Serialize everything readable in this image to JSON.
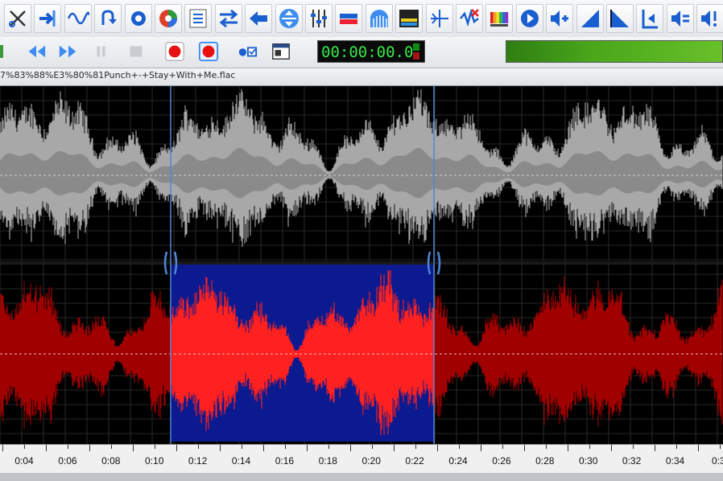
{
  "toolbar_top": {
    "buttons": [
      {
        "icon": "cut-tools-icon"
      },
      {
        "icon": "insert-arrow-icon"
      },
      {
        "icon": "sine-wave-icon"
      },
      {
        "icon": "undo-loop-icon"
      },
      {
        "icon": "gear-chip-icon"
      },
      {
        "icon": "color-wheel-icon"
      },
      {
        "icon": "marker-list-icon"
      },
      {
        "icon": "swap-channels-icon"
      },
      {
        "icon": "arrow-left-icon"
      },
      {
        "icon": "vertical-fit-icon"
      },
      {
        "icon": "equalizer-sliders-icon"
      },
      {
        "icon": "normalize-icon"
      },
      {
        "icon": "spectrum-arc-icon"
      },
      {
        "icon": "spectral-view-icon"
      },
      {
        "icon": "split-icon"
      },
      {
        "icon": "remove-noise-icon"
      },
      {
        "icon": "color-bars-icon"
      },
      {
        "icon": "play-circle-icon"
      },
      {
        "icon": "speaker-plus-icon"
      },
      {
        "icon": "fade-in-icon"
      },
      {
        "icon": "fade-out-icon"
      },
      {
        "icon": "trim-start-icon"
      },
      {
        "icon": "speaker-equal-icon"
      },
      {
        "icon": "speaker-warning-icon"
      }
    ]
  },
  "toolbar_second": {
    "buttons": [
      {
        "icon": "rewind-icon"
      },
      {
        "icon": "fast-forward-icon"
      },
      {
        "icon": "pause-icon"
      },
      {
        "icon": "stop-grid-icon"
      },
      {
        "icon": "record-icon"
      },
      {
        "icon": "record-loop-icon"
      },
      {
        "icon": "record-checkbox-icon"
      },
      {
        "icon": "window-view-icon"
      }
    ],
    "timer": "00:00:00.0"
  },
  "file": {
    "name": "7%83%88%E3%80%81Punch+-+Stay+With+Me.flac"
  },
  "waveform": {
    "channels": [
      "left",
      "right"
    ],
    "colors": {
      "left_channel": "#a8a8a8",
      "right_channel_selected": "#ff2020",
      "right_channel_unselected": "#a00000",
      "selection_background": "#0b1a8f",
      "cursor_lines": "#4f86d6"
    },
    "selection": {
      "start": "0:10.7",
      "end": "0:22.8"
    }
  },
  "timeline": {
    "labels": [
      "0:04",
      "0:06",
      "0:08",
      "0:10",
      "0:12",
      "0:14",
      "0:16",
      "0:18",
      "0:20",
      "0:22",
      "0:24",
      "0:26",
      "0:28",
      "0:30",
      "0:32",
      "0:34",
      "0:3"
    ]
  }
}
